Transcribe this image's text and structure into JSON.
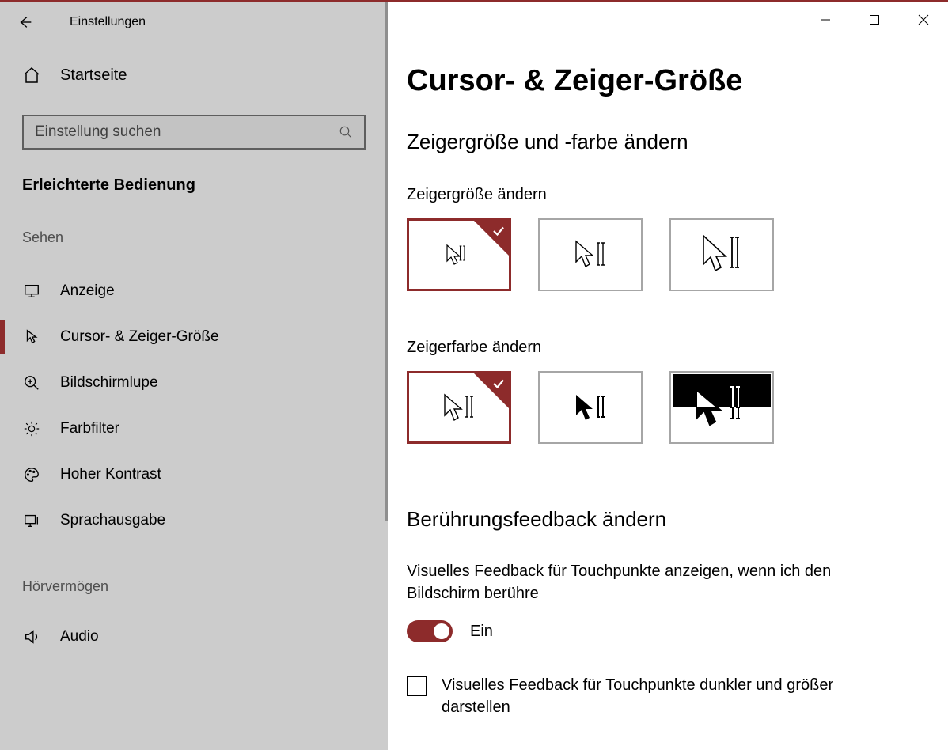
{
  "window": {
    "title": "Einstellungen"
  },
  "sidebar": {
    "home": "Startseite",
    "search_placeholder": "Einstellung suchen",
    "category": "Erleichterte Bedienung",
    "groups": [
      {
        "title": "Sehen",
        "items": [
          {
            "label": "Anzeige",
            "icon": "monitor-icon",
            "selected": false
          },
          {
            "label": "Cursor- & Zeiger-Größe",
            "icon": "cursor-icon",
            "selected": true
          },
          {
            "label": "Bildschirmlupe",
            "icon": "magnifier-plus-icon",
            "selected": false
          },
          {
            "label": "Farbfilter",
            "icon": "brightness-icon",
            "selected": false
          },
          {
            "label": "Hoher Kontrast",
            "icon": "palette-icon",
            "selected": false
          },
          {
            "label": "Sprachausgabe",
            "icon": "narrator-icon",
            "selected": false
          }
        ]
      },
      {
        "title": "Hörvermögen",
        "items": [
          {
            "label": "Audio",
            "icon": "speaker-icon",
            "selected": false
          }
        ]
      }
    ]
  },
  "content": {
    "page_title": "Cursor- & Zeiger-Größe",
    "section_size_color": "Zeigergröße und -farbe ändern",
    "pointer_size_label": "Zeigergröße ändern",
    "pointer_size_options": [
      {
        "selected": true,
        "size": "small"
      },
      {
        "selected": false,
        "size": "medium"
      },
      {
        "selected": false,
        "size": "large"
      }
    ],
    "pointer_color_label": "Zeigerfarbe ändern",
    "pointer_color_options": [
      {
        "selected": true,
        "style": "white"
      },
      {
        "selected": false,
        "style": "black"
      },
      {
        "selected": false,
        "style": "inverted"
      }
    ],
    "touch_section": "Berührungsfeedback ändern",
    "touch_desc": "Visuelles Feedback für Touchpunkte anzeigen, wenn ich den Bildschirm berühre",
    "touch_toggle_state": "Ein",
    "touch_toggle_on": true,
    "touch_checkbox_label": "Visuelles Feedback für Touchpunkte dunkler und größer darstellen",
    "touch_checkbox_checked": false
  },
  "colors": {
    "accent": "#8d2b2b"
  }
}
